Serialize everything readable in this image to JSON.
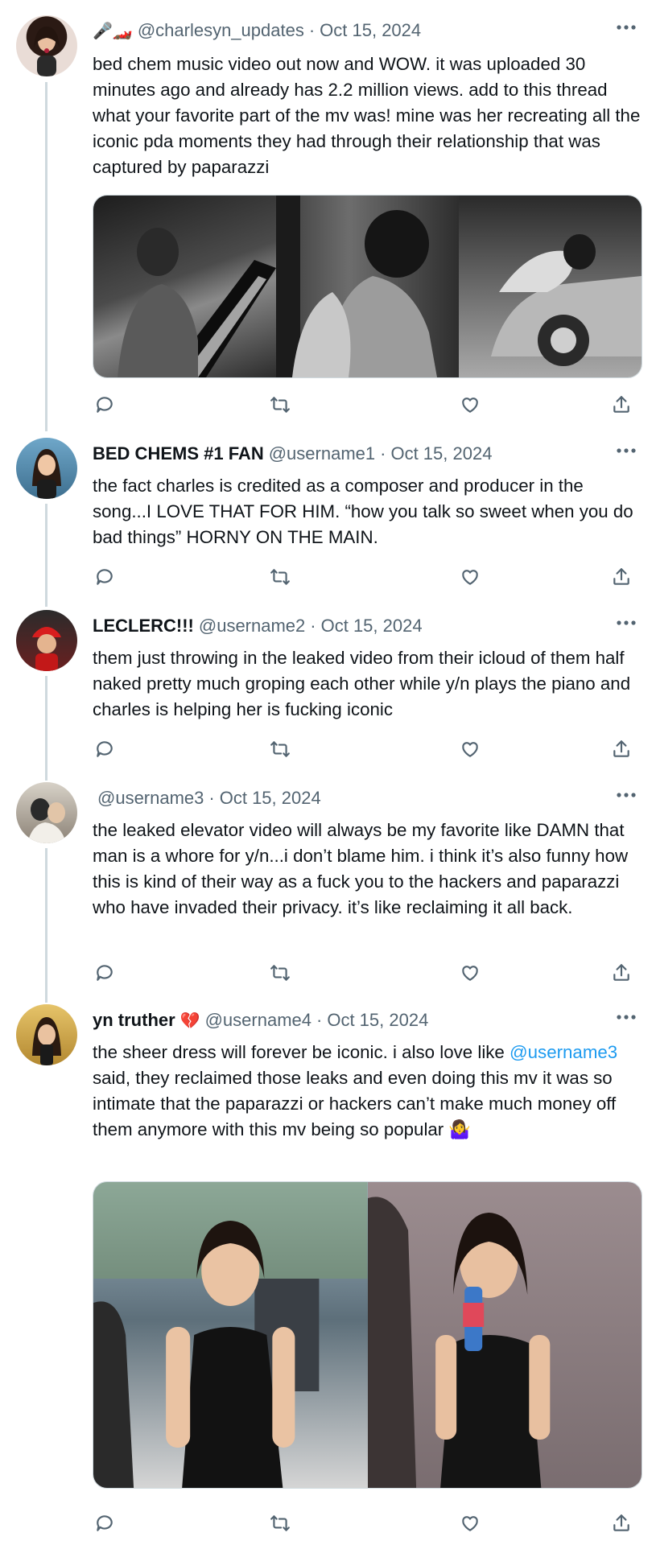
{
  "tweets": [
    {
      "header_icons": "🎤🏎️",
      "name": "",
      "handle": "@charlesyn_updates",
      "date": "Oct 15, 2024",
      "text": "bed chem music video out now and WOW. it was uploaded 30 minutes ago and already has 2.2 million views. add to this thread what your favorite part of the mv was! mine was her recreating all the iconic pda moments they had through their relationship that was captured by paparazzi",
      "media": [
        "grayscale-piano-photo",
        "grayscale-embrace-photo",
        "grayscale-car-photo"
      ]
    },
    {
      "name": "BED CHEMS #1 FAN",
      "handle": "@username1",
      "date": "Oct 15, 2024",
      "text": "the fact charles is credited as a composer and producer in the song...I LOVE THAT FOR HIM. “how you talk so sweet when you do bad things” HORNY ON THE MAIN."
    },
    {
      "name": "LECLERC!!!",
      "handle": "@username2",
      "date": "Oct 15, 2024",
      "text": "them just throwing in the leaked video from their icloud of them half naked pretty much groping each other while y/n plays the piano and charles is helping her is fucking iconic"
    },
    {
      "name": "",
      "handle": "@username3",
      "date": "Oct 15, 2024",
      "text": "the leaked elevator video will always be my favorite like DAMN that man is a whore for y/n...i don’t blame him. i think it’s also funny how this is kind of their way as a fuck you to the hackers and paparazzi who have invaded their privacy. it’s like reclaiming it all back."
    },
    {
      "name": "yn truther",
      "name_emoji": "💔",
      "handle": "@username4",
      "date": "Oct 15, 2024",
      "text_before": "the sheer dress will forever be iconic. i also love like ",
      "mention": "@username3",
      "text_after": " said, they reclaimed those leaks and even doing this mv it was so intimate that the paparazzi or hackers can’t make much money off them anymore with this mv being so popular 🤷‍♀️",
      "media": [
        "black-dress-photo-left",
        "black-dress-photo-right"
      ]
    }
  ],
  "actions": {
    "reply": "reply-icon",
    "retweet": "retweet-icon",
    "like": "heart-icon",
    "share": "share-icon"
  }
}
